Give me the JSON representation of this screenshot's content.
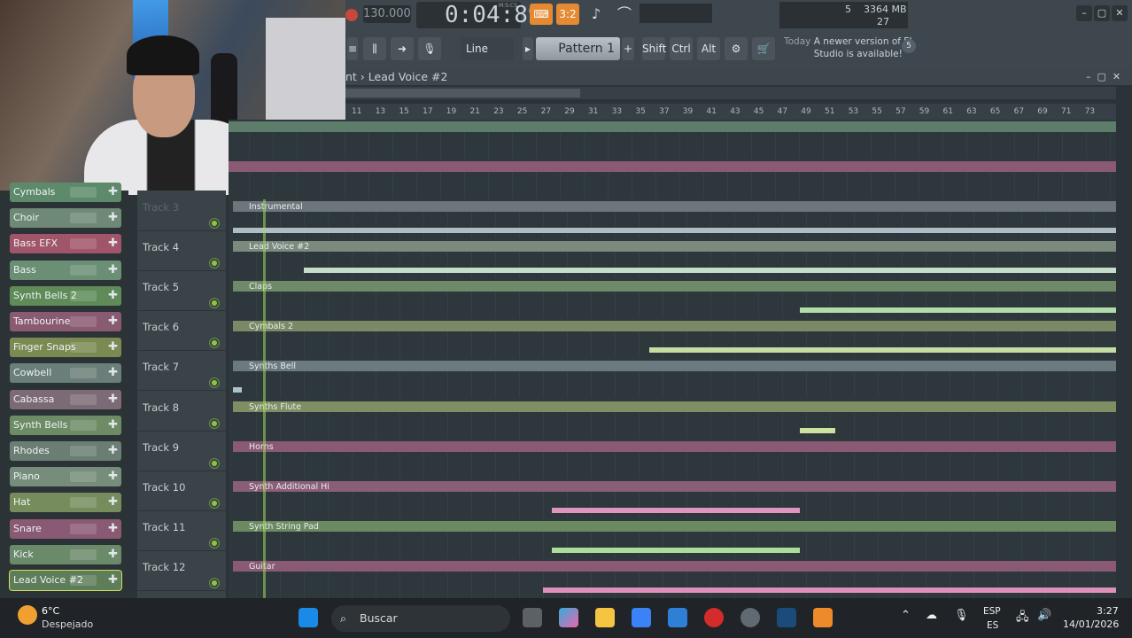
{
  "toolbar": {
    "tempo": "130.000",
    "time": "0:04:89",
    "time_label": "M:S:CS",
    "pattern_label": "Pattern 1",
    "mode_label": "Line",
    "keys": [
      "Shift",
      "Ctrl",
      "Alt"
    ],
    "cpu_count": "5",
    "memory": "3364 MB",
    "voices": "27",
    "news_day": "Today",
    "news_text": "A newer version of FL Studio is available!",
    "news_badge": "5"
  },
  "playlist": {
    "title": "nt › Lead Voice #2",
    "ruler": [
      "11",
      "13",
      "15",
      "17",
      "19",
      "21",
      "23",
      "25",
      "27",
      "29",
      "31",
      "33",
      "35",
      "37",
      "39",
      "41",
      "43",
      "45",
      "47",
      "49",
      "51",
      "53",
      "55",
      "57",
      "59",
      "61",
      "63",
      "65",
      "67",
      "69",
      "71",
      "73"
    ]
  },
  "channels": [
    {
      "name": "Cymbals",
      "color": "#5d8a6a"
    },
    {
      "name": "Choir",
      "color": "#6e8a76"
    },
    {
      "name": "Bass EFX",
      "color": "#a0556a"
    },
    {
      "name": "Bass",
      "color": "#6a8f74"
    },
    {
      "name": "Synth Bells 2",
      "color": "#5f8b59"
    },
    {
      "name": "Tambourine",
      "color": "#8a5a72"
    },
    {
      "name": "Finger Snaps",
      "color": "#7b8a52"
    },
    {
      "name": "Cowbell",
      "color": "#6b7f7a"
    },
    {
      "name": "Cabassa",
      "color": "#7c6b76"
    },
    {
      "name": "Synth Bells",
      "color": "#6d8c66"
    },
    {
      "name": "Rhodes",
      "color": "#6a7e73"
    },
    {
      "name": "Piano",
      "color": "#758d7a"
    },
    {
      "name": "Hat",
      "color": "#778c5c"
    },
    {
      "name": "Snare",
      "color": "#8a5a74"
    },
    {
      "name": "Kick",
      "color": "#6b8a6a"
    },
    {
      "name": "Lead Voice #2",
      "color": "#5e7e5a"
    }
  ],
  "tracks": [
    {
      "header": "Track 3",
      "clip": "Instrumental",
      "color": "#6d767b"
    },
    {
      "header": "Track 4",
      "clip": "Lead Voice #2",
      "color": "#7c8a7e"
    },
    {
      "header": "Track 5",
      "clip": "Claps",
      "color": "#6f8a69"
    },
    {
      "header": "Track 6",
      "clip": "Cymbals 2",
      "color": "#7a8a66"
    },
    {
      "header": "Track 7",
      "clip": "Synths Bell",
      "color": "#6b7a7f"
    },
    {
      "header": "Track 8",
      "clip": "Synths Flute",
      "color": "#7f8e63"
    },
    {
      "header": "Track 9",
      "clip": "Horns",
      "color": "#8a5a74"
    },
    {
      "header": "Track 10",
      "clip": "Synth Additional Hi",
      "color": "#8b5e77"
    },
    {
      "header": "Track 11",
      "clip": "Synth String Pad",
      "color": "#6c8a62"
    },
    {
      "header": "Track 12",
      "clip": "Guitar",
      "color": "#8a5a74"
    }
  ],
  "taskbar": {
    "weather_temp": "6°C",
    "weather_desc": "Despejado",
    "search_placeholder": "Buscar",
    "lang_top": "ESP",
    "lang_bottom": "ES",
    "clock_time": "3:27",
    "clock_date": "14/01/2026"
  }
}
